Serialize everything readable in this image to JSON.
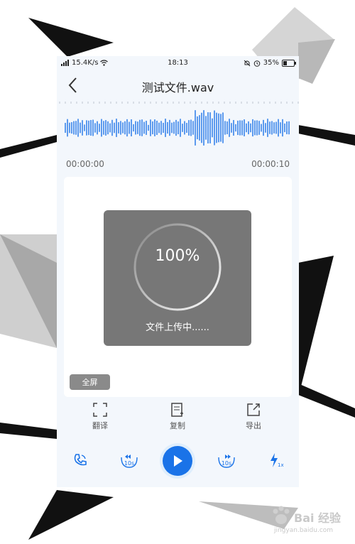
{
  "status_bar": {
    "speed": "15.4K/s",
    "time": "18:13",
    "battery": "35%",
    "battery_level": 0.35,
    "signal_icon": "signal-icon",
    "wifi_icon": "wifi-icon"
  },
  "header": {
    "title": "测试文件.wav",
    "back_icon": "chevron-left-icon"
  },
  "player": {
    "time_start": "00:00:00",
    "time_end": "00:00:10"
  },
  "upload": {
    "progress_text": "100%",
    "progress": 1.0,
    "status": "文件上传中......"
  },
  "fullscreen_label": "全屏",
  "actions": [
    {
      "label": "翻译",
      "icon": "translate-icon"
    },
    {
      "label": "复制",
      "icon": "copy-icon"
    },
    {
      "label": "导出",
      "icon": "export-icon"
    }
  ],
  "controls": {
    "call_icon": "phone-icon",
    "rewind_label": "10s",
    "forward_label": "10s",
    "speed_label": "1x",
    "play_icon": "play-icon"
  },
  "watermark": {
    "text": "Bai 经验",
    "url": "jingyan.baidu.com"
  },
  "colors": {
    "accent": "#1a73e8",
    "background": "#f3f7fc",
    "overlay": "#777777"
  }
}
